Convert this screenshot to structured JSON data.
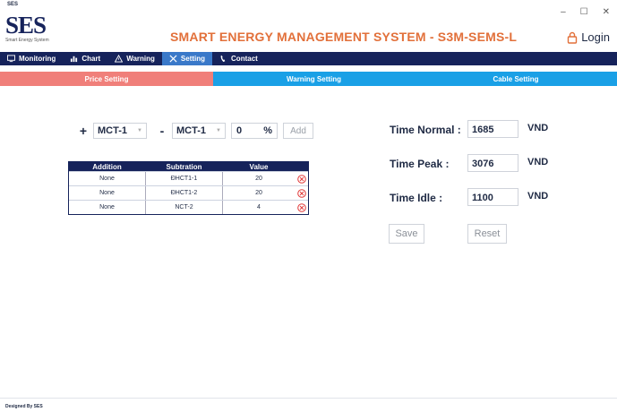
{
  "window": {
    "small_label": "SES",
    "minimize": "–",
    "maximize": "☐",
    "close": "✕"
  },
  "logo": {
    "text": "SES",
    "subtext": "Smart Energy System"
  },
  "app_title": "SMART ENERGY MANAGEMENT SYSTEM - S3M-SEMS-L",
  "login_label": "Login",
  "menu": [
    {
      "label": "Monitoring",
      "icon": "monitor-icon"
    },
    {
      "label": "Chart",
      "icon": "bar-chart-icon"
    },
    {
      "label": "Warning",
      "icon": "warning-icon"
    },
    {
      "label": "Setting",
      "icon": "settings-icon",
      "active": true
    },
    {
      "label": "Contact",
      "icon": "phone-icon"
    }
  ],
  "tabs": {
    "price": "Price Setting",
    "warning": "Warning Setting",
    "cable": "Cable Setting"
  },
  "controls": {
    "plus": "+",
    "minus": "-",
    "addition_select": "MCT-1",
    "subtraction_select": "MCT-1",
    "percent_value": "0",
    "percent_unit": "%",
    "add_button": "Add"
  },
  "table": {
    "headers": [
      "Addition",
      "Subtration",
      "Value"
    ],
    "rows": [
      {
        "addition": "None",
        "subtraction": "ĐHCT1-1",
        "value": "20"
      },
      {
        "addition": "None",
        "subtraction": "ĐHCT1-2",
        "value": "20"
      },
      {
        "addition": "None",
        "subtraction": "NCT-2",
        "value": "4"
      }
    ]
  },
  "time_fields": {
    "normal": {
      "label": "Time Normal :",
      "value": "1685",
      "unit": "VND"
    },
    "peak": {
      "label": "Time Peak :",
      "value": "3076",
      "unit": "VND"
    },
    "idle": {
      "label": "Time Idle :",
      "value": "1100",
      "unit": "VND"
    }
  },
  "buttons": {
    "save": "Save",
    "reset": "Reset"
  },
  "footer": "Designed By SES",
  "colors": {
    "navy": "#16235b",
    "accent_orange": "#e2703a",
    "tab_active": "#f07f7a",
    "tab_inactive": "#1aa0e6",
    "delete_red": "#e23b3b"
  }
}
